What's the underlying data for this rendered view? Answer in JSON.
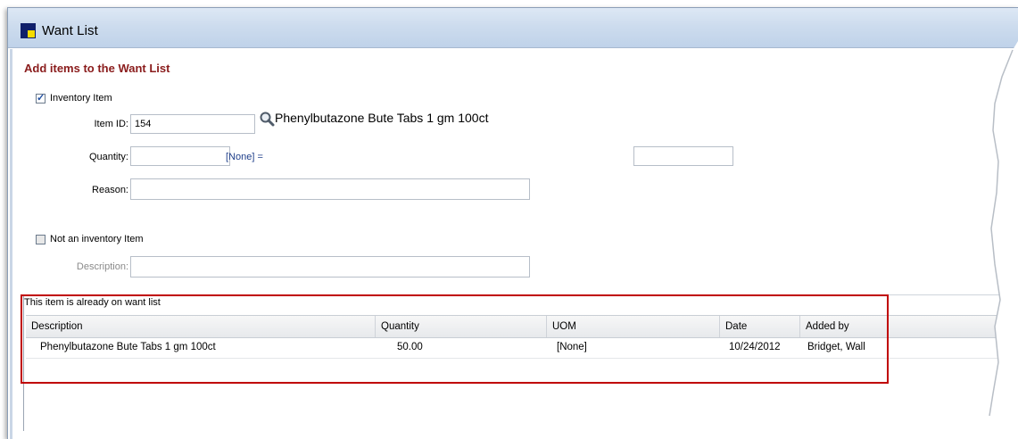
{
  "window": {
    "title": "Want  List"
  },
  "form": {
    "heading": "Add items to the Want List",
    "inventory_checkbox": {
      "label": "Inventory Item",
      "checked": true
    },
    "item_id": {
      "label": "Item ID:",
      "value": "154"
    },
    "item_name": "Phenylbutazone Bute Tabs 1 gm 100ct",
    "quantity": {
      "label": "Quantity:",
      "value": "",
      "uom_text": "[None] =",
      "converted_value": ""
    },
    "reason": {
      "label": "Reason:",
      "value": ""
    },
    "not_inventory_checkbox": {
      "label": "Not an inventory Item",
      "checked": false
    },
    "description": {
      "label": "Description:",
      "value": ""
    }
  },
  "want_list_grid": {
    "notice": "This item is already on want list",
    "columns": [
      "Description",
      "Quantity",
      "UOM",
      "Date",
      "Added by"
    ],
    "rows": [
      [
        "Phenylbutazone Bute Tabs 1 gm 100ct",
        "50.00",
        "[None]",
        "10/24/2012",
        "Bridget, Wall"
      ]
    ]
  },
  "icons": {
    "app": "app-logo-icon",
    "search": "magnifier-icon"
  },
  "colors": {
    "heading": "#8a1c1c",
    "highlight_box": "#c00000",
    "titlebar": "#cddcee",
    "uom_link": "#1f3f8a"
  }
}
